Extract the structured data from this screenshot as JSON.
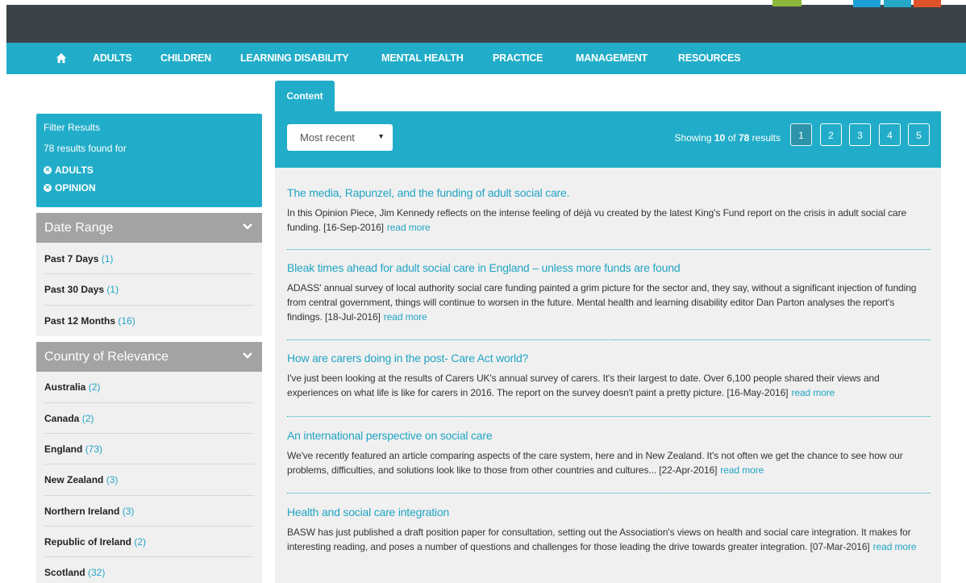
{
  "nav": {
    "home_icon": "home-icon",
    "items": [
      "ADULTS",
      "CHILDREN",
      "LEARNING DISABILITY",
      "MENTAL HEALTH",
      "PRACTICE",
      "MANAGEMENT",
      "RESOURCES"
    ]
  },
  "filter": {
    "title": "Filter Results",
    "count_text": "78 results found for",
    "tags": [
      "ADULTS",
      "OPINION"
    ]
  },
  "date_range": {
    "title": "Date Range",
    "items": [
      {
        "label": "Past 7 Days",
        "count": "(1)"
      },
      {
        "label": "Past 30 Days",
        "count": "(1)"
      },
      {
        "label": "Past 12 Months",
        "count": "(16)"
      }
    ]
  },
  "country": {
    "title": "Country of Relevance",
    "items": [
      {
        "label": "Australia",
        "count": "(2)"
      },
      {
        "label": "Canada",
        "count": "(2)"
      },
      {
        "label": "England",
        "count": "(73)"
      },
      {
        "label": "New Zealand",
        "count": "(3)"
      },
      {
        "label": "Northern Ireland",
        "count": "(3)"
      },
      {
        "label": "Republic of Ireland",
        "count": "(2)"
      },
      {
        "label": "Scotland",
        "count": "(32)"
      }
    ]
  },
  "content": {
    "tab_label": "Content",
    "sort_value": "Most recent",
    "showing_prefix": "Showing",
    "showing_count": "10",
    "showing_of": "of",
    "showing_total": "78",
    "showing_suffix": "results",
    "pages": [
      "1",
      "2",
      "3",
      "4",
      "5"
    ],
    "active_page": "1",
    "read_more": "read more",
    "articles": [
      {
        "title": "The media, Rapunzel, and the funding of adult social care.",
        "desc": "In this Opinion Piece, Jim Kennedy reflects on the intense feeling of déjà vu created by the latest King's Fund report on the crisis in adult social care funding. [16-Sep-2016]"
      },
      {
        "title": "Bleak times ahead for adult social care in England – unless more funds are found",
        "desc": "ADASS' annual survey of local authority social care funding painted a grim picture for the sector and, they say, without a significant injection of funding from central government, things will continue to worsen in the future. Mental health and learning disability editor Dan Parton analyses the report's findings. [18-Jul-2016]"
      },
      {
        "title": "How are carers doing in the post- Care Act world?",
        "desc": "I've just been looking at the results of Carers UK's annual survey of carers. It's their largest to date. Over 6,100 people shared their views and experiences on what life is like for carers in 2016. The report on the survey doesn't paint a pretty picture. [16-May-2016]"
      },
      {
        "title": "An international perspective on social care",
        "desc": "We've recently featured an article comparing aspects of the care system, here and in New Zealand. It's not often we get the chance to see how our problems, difficulties, and solutions look like to those from other countries and cultures... [22-Apr-2016]"
      },
      {
        "title": "Health and social care integration",
        "desc": "BASW has just published a draft position paper for consultation, setting out the Association's views on health and social care integration. It makes for interesting reading, and poses a number of questions and challenges for those leading the drive towards greater integration. [07-Mar-2016]"
      }
    ]
  }
}
